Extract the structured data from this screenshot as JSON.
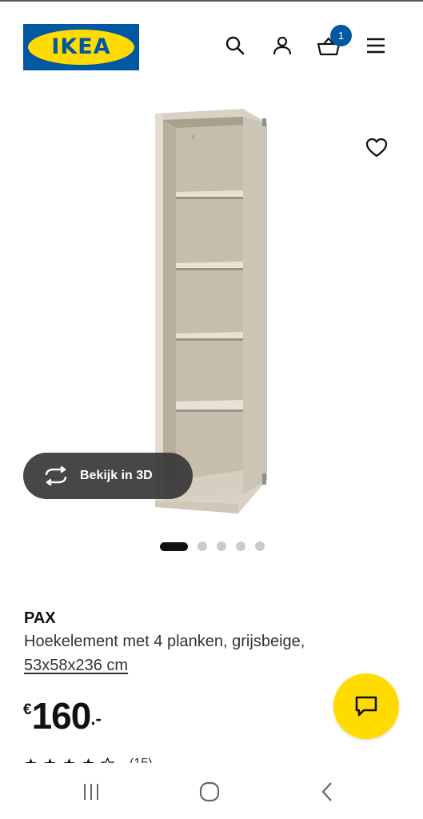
{
  "header": {
    "logo_text": "IKEA",
    "logo_mark": "®",
    "cart_count": "1",
    "icons": [
      "search-icon",
      "user-icon",
      "basket-icon",
      "menu-icon"
    ]
  },
  "gallery": {
    "view_3d_label": "Bekijk in 3D",
    "slide_count": 5,
    "active_slide": 1
  },
  "product": {
    "name": "PAX",
    "description": "Hoekelement met 4 planken, grijsbeige,",
    "dimensions": "53x58x236 cm",
    "price_currency": "€",
    "price_integer": "160",
    "price_decimal": ".-",
    "rating_count": "(15)"
  },
  "colors": {
    "ikea_blue": "#0058a3",
    "ikea_yellow": "#ffdb00"
  }
}
